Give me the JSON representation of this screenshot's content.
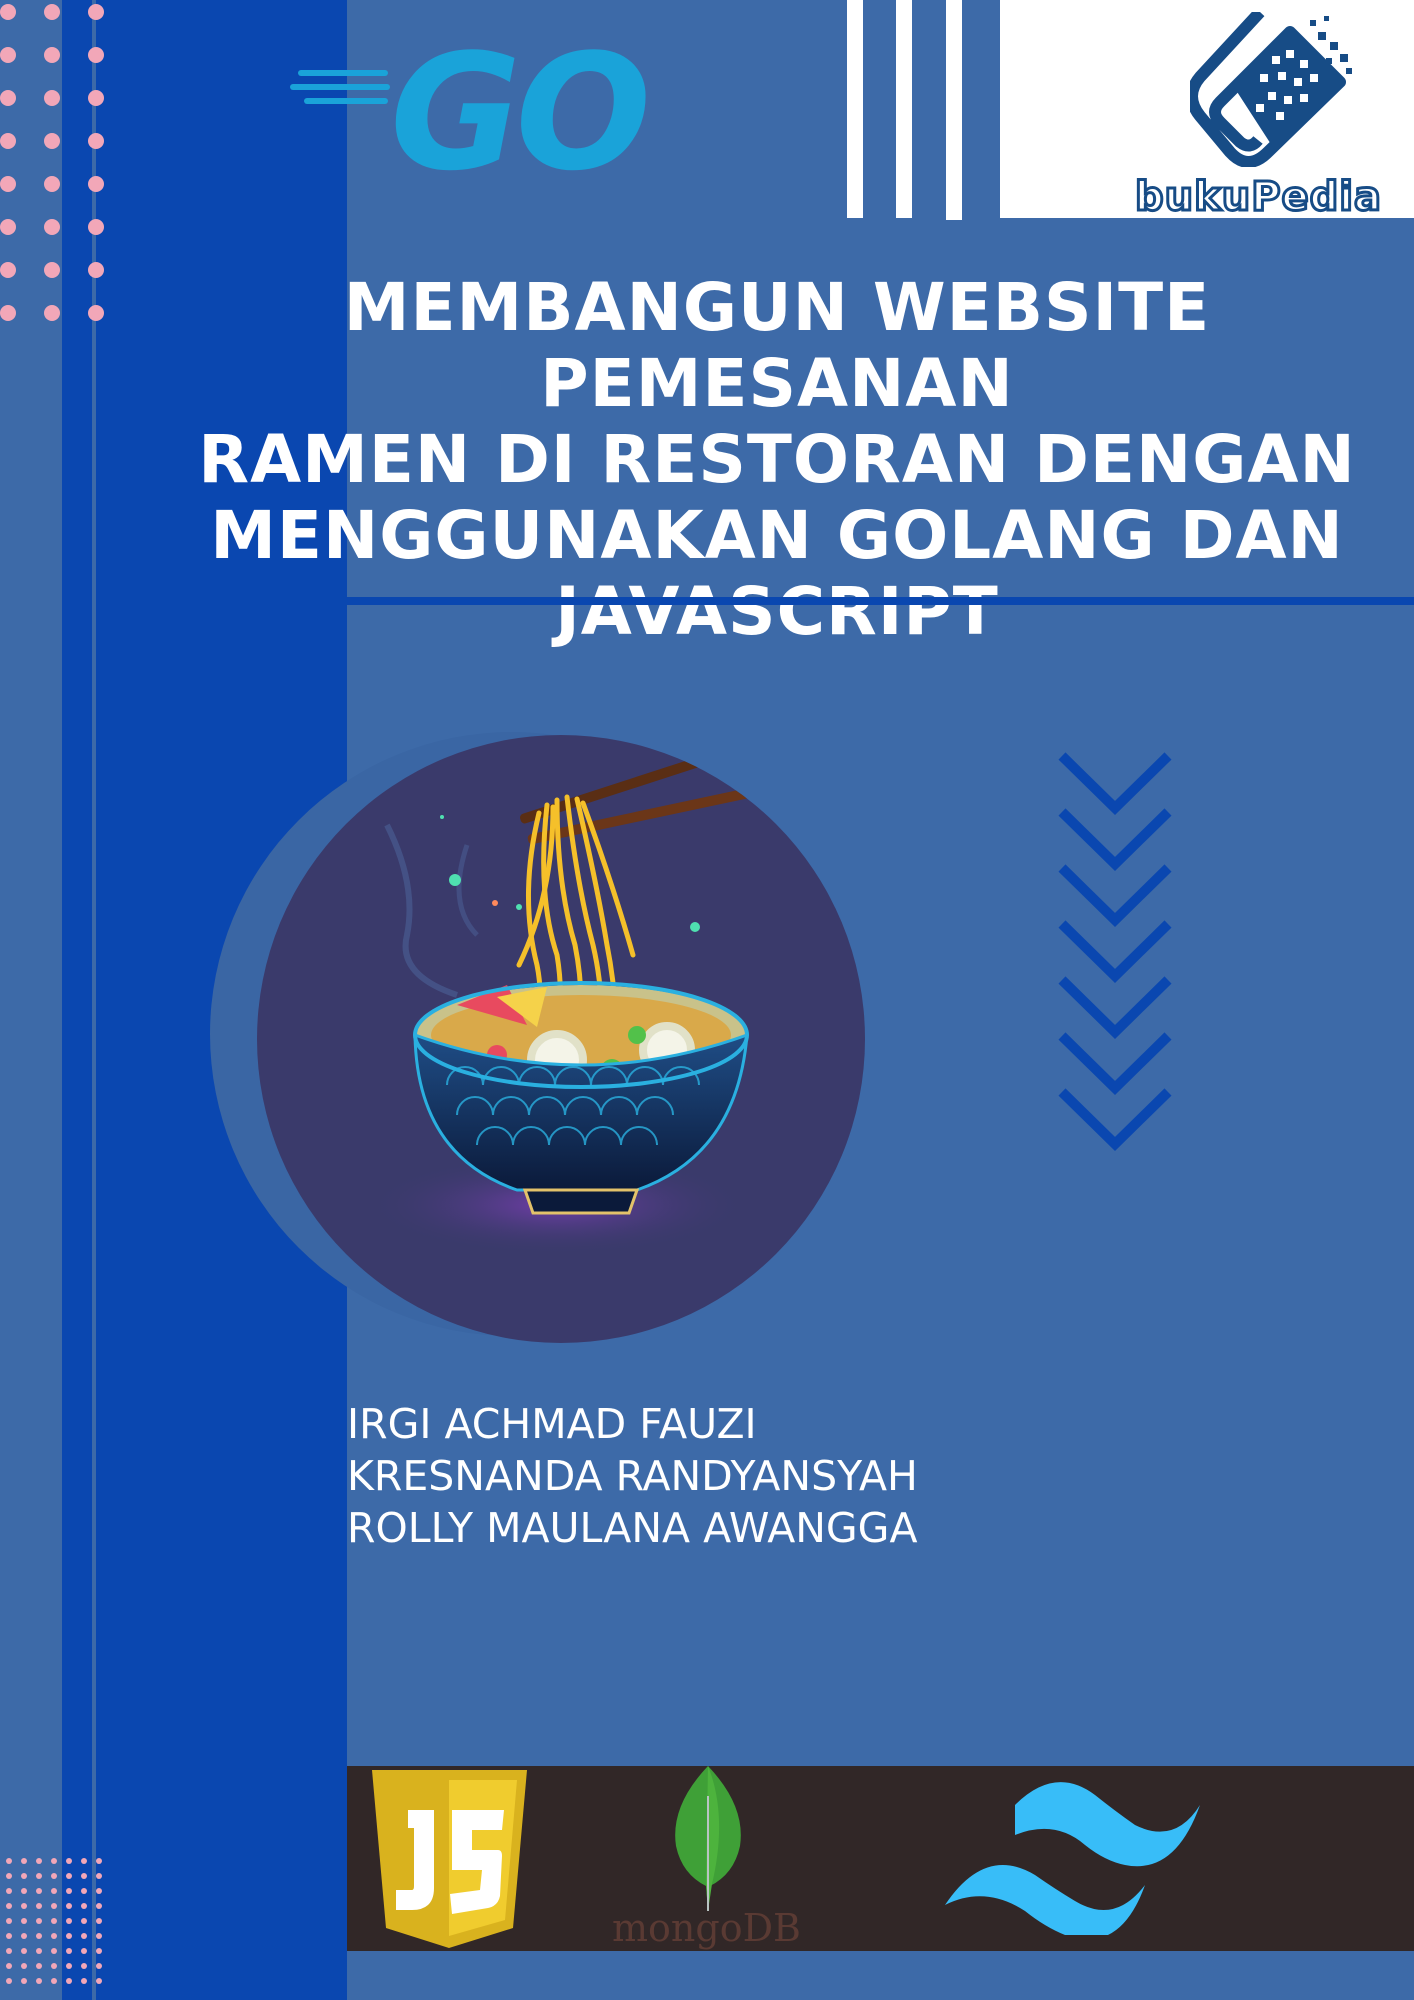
{
  "logos": {
    "go": "GO",
    "publisher": "bukuPedia",
    "mongodb": "mongoDB"
  },
  "title_lines": [
    "MEMBANGUN WEBSITE PEMESANAN",
    "RAMEN DI RESTORAN DENGAN",
    "MENGGUNAKAN GOLANG DAN",
    "JAVASCRIPT"
  ],
  "authors": [
    "IRGI ACHMAD FAUZI",
    "KRESNANDA RANDYANSYAH",
    "ROLLY MAULANA AWANGGA"
  ],
  "icons": [
    "go-logo",
    "bukupedia-book-icon",
    "ramen-bowl-illustration",
    "chevron-down-icon",
    "javascript-logo",
    "mongodb-leaf-icon",
    "tailwind-logo"
  ],
  "colors": {
    "background": "#3d6aa8",
    "left_band": "#0a47b0",
    "accent_pink": "#f2a7b8",
    "go_cyan": "#1aa3d9",
    "tech_bar": "#312727"
  }
}
